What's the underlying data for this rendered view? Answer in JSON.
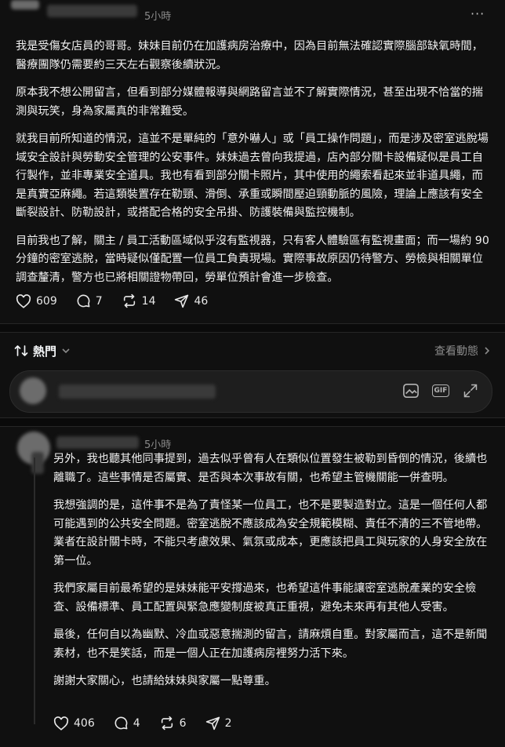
{
  "post1": {
    "time": "5小時",
    "more_glyph": "···",
    "paragraphs": [
      "我是受傷女店員的哥哥。妹妹目前仍在加護病房治療中，因為目前無法確認實際腦部缺氧時間，醫療團隊仍需要約三天左右觀察後續狀況。",
      "原本我不想公開留言，但看到部分媒體報導與網路留言並不了解實際情況，甚至出現不恰當的揣測與玩笑，身為家屬真的非常難受。",
      "就我目前所知道的情況，這並不是單純的「意外嚇人」或「員工操作問題」，而是涉及密室逃脫場域安全設計與勞動安全管理的公安事件。妹妹過去曾向我提過，店內部分關卡設備疑似是員工自行製作，並非專業安全道具。我也有看到部分關卡照片，其中使用的繩索看起來並非道具繩，而是真實亞麻繩。若這類裝置存在勒頸、滑倒、承重或瞬間壓迫頸動脈的風險，理論上應該有安全斷裂設計、防勒設計，或搭配合格的安全吊掛、防護裝備與監控機制。",
      "目前我也了解，關主 / 員工活動區域似乎沒有監視器，只有客人體驗區有監視畫面；而一場約 90 分鐘的密室逃脫，當時疑似僅配置一位員工負責現場。實際事故原因仍待警方、勞檢與相關單位調查釐清，警方也已將相關證物帶回，勞單位預計會進一步檢查。"
    ],
    "likes": "609",
    "comments": "7",
    "reposts": "14",
    "shares": "46"
  },
  "sort": {
    "label": "熱門",
    "view_activity": "查看動態"
  },
  "reply": {
    "tools": [
      "image-icon",
      "gif-icon",
      "expand-icon"
    ],
    "gif_label": "GIF"
  },
  "post2": {
    "time": "5小時",
    "paragraphs": [
      "另外，我也聽其他同事提到，過去似乎曾有人在類似位置發生被勒到昏倒的情況，後續也離職了。這些事情是否屬實、是否與本次事故有關，也希望主管機關能一併查明。",
      "我想強調的是，這件事不是為了責怪某一位員工，也不是要製造對立。這是一個任何人都可能遇到的公共安全問題。密室逃脫不應該成為安全規範模糊、責任不清的三不管地帶。業者在設計關卡時，不能只考慮效果、氣氛或成本，更應該把員工與玩家的人身安全放在第一位。",
      "我們家屬目前最希望的是妹妹能平安撐過來，也希望這件事能讓密室逃脫產業的安全檢查、設備標準、員工配置與緊急應變制度被真正重視，避免未來再有其他人受害。",
      "最後，任何自以為幽默、冷血或惡意揣測的留言，請麻煩自重。對家屬而言，這不是新聞素材，也不是笑話，而是一個人正在加護病房裡努力活下來。",
      "謝謝大家關心，也請給妹妹與家屬一點尊重。"
    ],
    "likes": "406",
    "comments": "4",
    "reposts": "6",
    "shares": "2"
  }
}
